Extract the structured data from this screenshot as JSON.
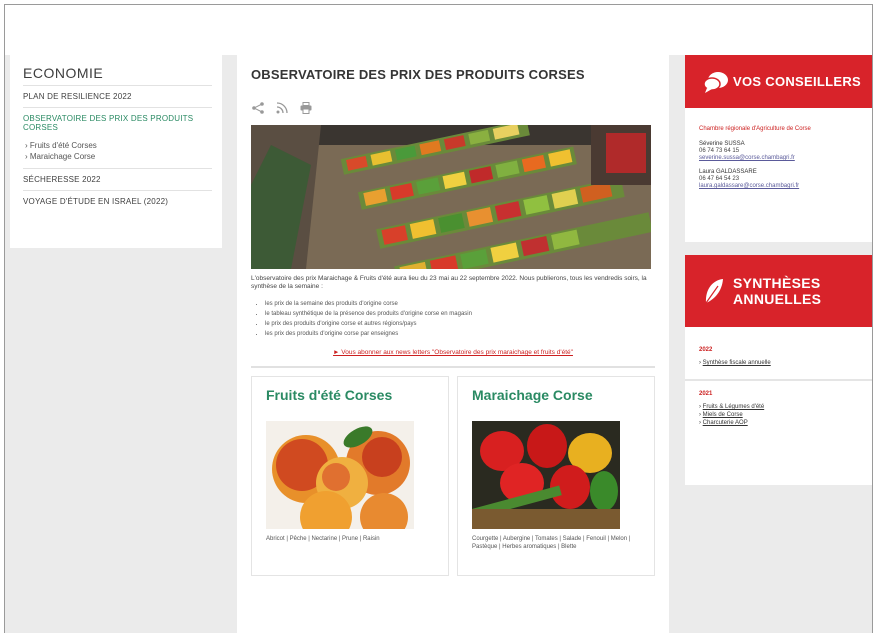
{
  "sidebar": {
    "title": "ECONOMIE",
    "items": [
      {
        "label": "PLAN DE RESILIENCE 2022"
      },
      {
        "label": "OBSERVATOIRE DES PRIX DES PRODUITS CORSES"
      },
      {
        "label": "SÉCHERESSE 2022"
      },
      {
        "label": "VOYAGE D'ÉTUDE EN ISRAEL (2022)"
      }
    ],
    "subitems": [
      "› Fruits d'été Corses",
      "› Maraichage Corse"
    ]
  },
  "main": {
    "title": "OBSERVATOIRE DES PRIX DES PRODUITS CORSES",
    "intro": "L'observatoire des prix Maraichage & Fruits d'été aura lieu du 23 mai au 22 septembre 2022. Nous publierons, tous les vendredis soirs, la synthèse de la semaine :",
    "bullets": [
      "les prix de la semaine des produits d'origine corse",
      "le tableau synthétique de la présence des produits d'origine corse en magasin",
      "le prix des produits d'origine corse et autres régions/pays",
      "les prix des produits d'origine corse par enseignes"
    ],
    "newsletter": "► Vous abonner aux news letters \"Observatoire des prix maraichage et fruits d'été\"",
    "cards": [
      {
        "title": "Fruits d'été Corses",
        "caption": "Abricot | Pêche | Nectarine | Prune | Raisin"
      },
      {
        "title": "Maraichage Corse",
        "caption": "Courgette | Aubergine | Tomates | Salade | Fenouil | Melon | Pastèque | Herbes aromatiques | Blette"
      }
    ]
  },
  "conseillers": {
    "title": "VOS CONSEILLERS",
    "chamber": "Chambre régionale d'Agriculture de Corse",
    "contacts": [
      {
        "name": "Séverine SUSSA",
        "phone": "06 74 73 64 15",
        "email": "severine.sussa@corse.chambagri.fr"
      },
      {
        "name": "Laura GALDASSARE",
        "phone": "06 47 64 54 23",
        "email": "laura.galdassare@corse.chambagri.fr"
      }
    ]
  },
  "syntheses": {
    "title_line1": "SYNTHÈSES",
    "title_line2": "ANNUELLES",
    "groups": [
      {
        "year": "2022",
        "links": [
          "Synthèse fiscale annuelle"
        ]
      },
      {
        "year": "2021",
        "links": [
          "Fruits & Légumes d'été",
          "Miels de Corse",
          "Charcuterie AOP"
        ]
      }
    ]
  },
  "colors": {
    "accent": "#d8232a",
    "green": "#2a8a63"
  },
  "icons": [
    "share-icon",
    "rss-icon",
    "print-icon",
    "chat-bubble-icon",
    "leaf-icon"
  ]
}
